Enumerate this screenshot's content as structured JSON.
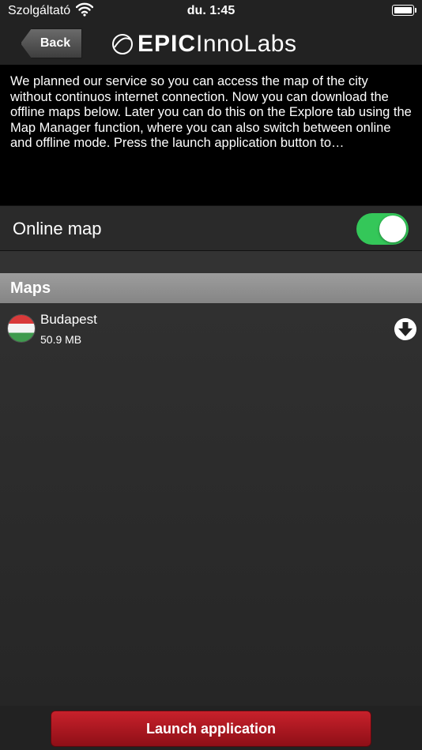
{
  "status_bar": {
    "carrier": "Szolgáltató",
    "time": "du. 1:45"
  },
  "nav": {
    "back_label": "Back",
    "logo_bold": "EPIC",
    "logo_light": "InnoLabs"
  },
  "intro_text": "We planned our service so you can access the map of the city without continuos internet connection. Now you can download the offline maps below. Later you can do this on the Explore tab using the Map Manager function, where you can also switch between online and offline mode. Press the launch application button to…",
  "online_map": {
    "label": "Online map",
    "enabled": true,
    "accent_color": "#34c759"
  },
  "maps_section": {
    "title": "Maps",
    "items": [
      {
        "name": "Budapest",
        "size": "50.9 MB",
        "icon": "hungary-flag-icon"
      }
    ]
  },
  "launch_label": "Launch application",
  "colors": {
    "launch": "#b81b24"
  }
}
